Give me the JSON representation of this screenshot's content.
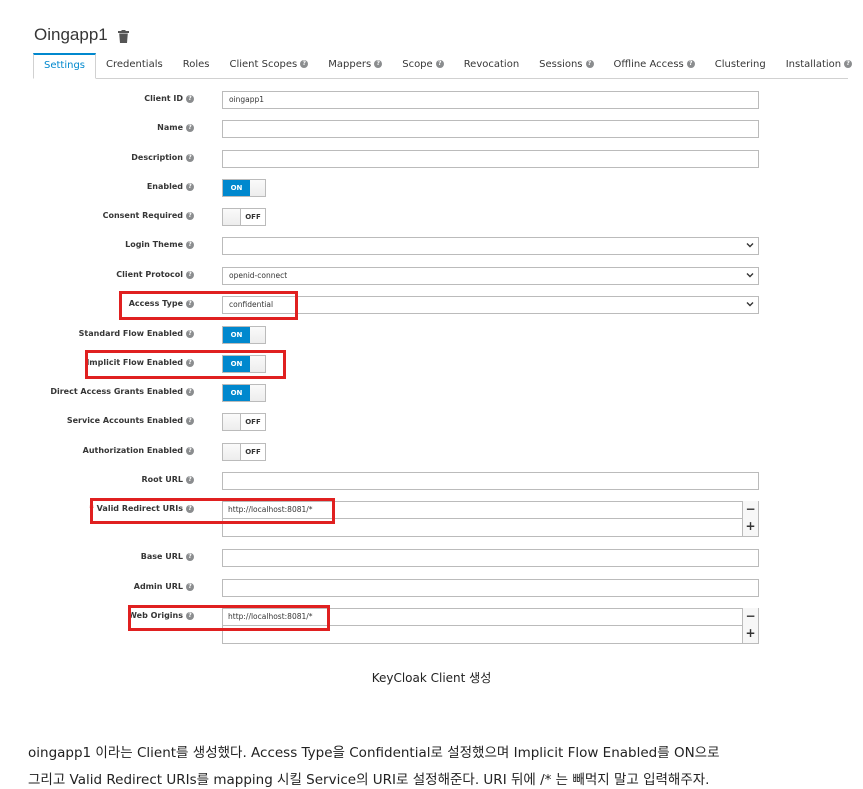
{
  "header": {
    "title": "Oingapp1"
  },
  "tabs": [
    {
      "label": "Settings",
      "help": false
    },
    {
      "label": "Credentials",
      "help": false
    },
    {
      "label": "Roles",
      "help": false
    },
    {
      "label": "Client Scopes",
      "help": true
    },
    {
      "label": "Mappers",
      "help": true
    },
    {
      "label": "Scope",
      "help": true
    },
    {
      "label": "Revocation",
      "help": false
    },
    {
      "label": "Sessions",
      "help": true
    },
    {
      "label": "Offline Access",
      "help": true
    },
    {
      "label": "Clustering",
      "help": false
    },
    {
      "label": "Installation",
      "help": true
    }
  ],
  "form": {
    "client_id": {
      "label": "Client ID",
      "value": "oingapp1"
    },
    "name": {
      "label": "Name",
      "value": ""
    },
    "description": {
      "label": "Description",
      "value": ""
    },
    "enabled": {
      "label": "Enabled",
      "state": "ON"
    },
    "consent_required": {
      "label": "Consent Required",
      "state": "OFF"
    },
    "login_theme": {
      "label": "Login Theme",
      "value": ""
    },
    "client_protocol": {
      "label": "Client Protocol",
      "value": "openid-connect"
    },
    "access_type": {
      "label": "Access Type",
      "value": "confidential"
    },
    "standard_flow": {
      "label": "Standard Flow Enabled",
      "state": "ON"
    },
    "implicit_flow": {
      "label": "Implicit Flow Enabled",
      "state": "ON"
    },
    "direct_access": {
      "label": "Direct Access Grants Enabled",
      "state": "ON"
    },
    "service_accounts": {
      "label": "Service Accounts Enabled",
      "state": "OFF"
    },
    "authorization": {
      "label": "Authorization Enabled",
      "state": "OFF"
    },
    "root_url": {
      "label": "Root URL",
      "value": ""
    },
    "valid_redirect": {
      "label": "Valid Redirect URIs",
      "required_mark": "*",
      "value": "http://localhost:8081/*",
      "minus": "−",
      "plus": "+"
    },
    "base_url": {
      "label": "Base URL",
      "value": ""
    },
    "admin_url": {
      "label": "Admin URL",
      "value": ""
    },
    "web_origins": {
      "label": "Web Origins",
      "value": "http://localhost:8081/*",
      "minus": "−",
      "plus": "+"
    }
  },
  "caption": "KeyCloak Client 생성",
  "paragraph": {
    "line1": "oingapp1 이라는 Client를 생성했다. Access Type을 Confidential로 설정했으며 Implicit Flow Enabled를 ON으로",
    "line2": "그리고 Valid Redirect URIs를 mapping 시킬 Service의 URI로 설정해준다. URI 뒤에 /* 는 빼먹지 말고 입력해주자."
  },
  "colors": {
    "accent": "#0088ce",
    "highlight": "#e02020"
  },
  "icons": {
    "trash": "trash-icon",
    "help": "help-icon",
    "chevron": "chevron-down-icon"
  }
}
